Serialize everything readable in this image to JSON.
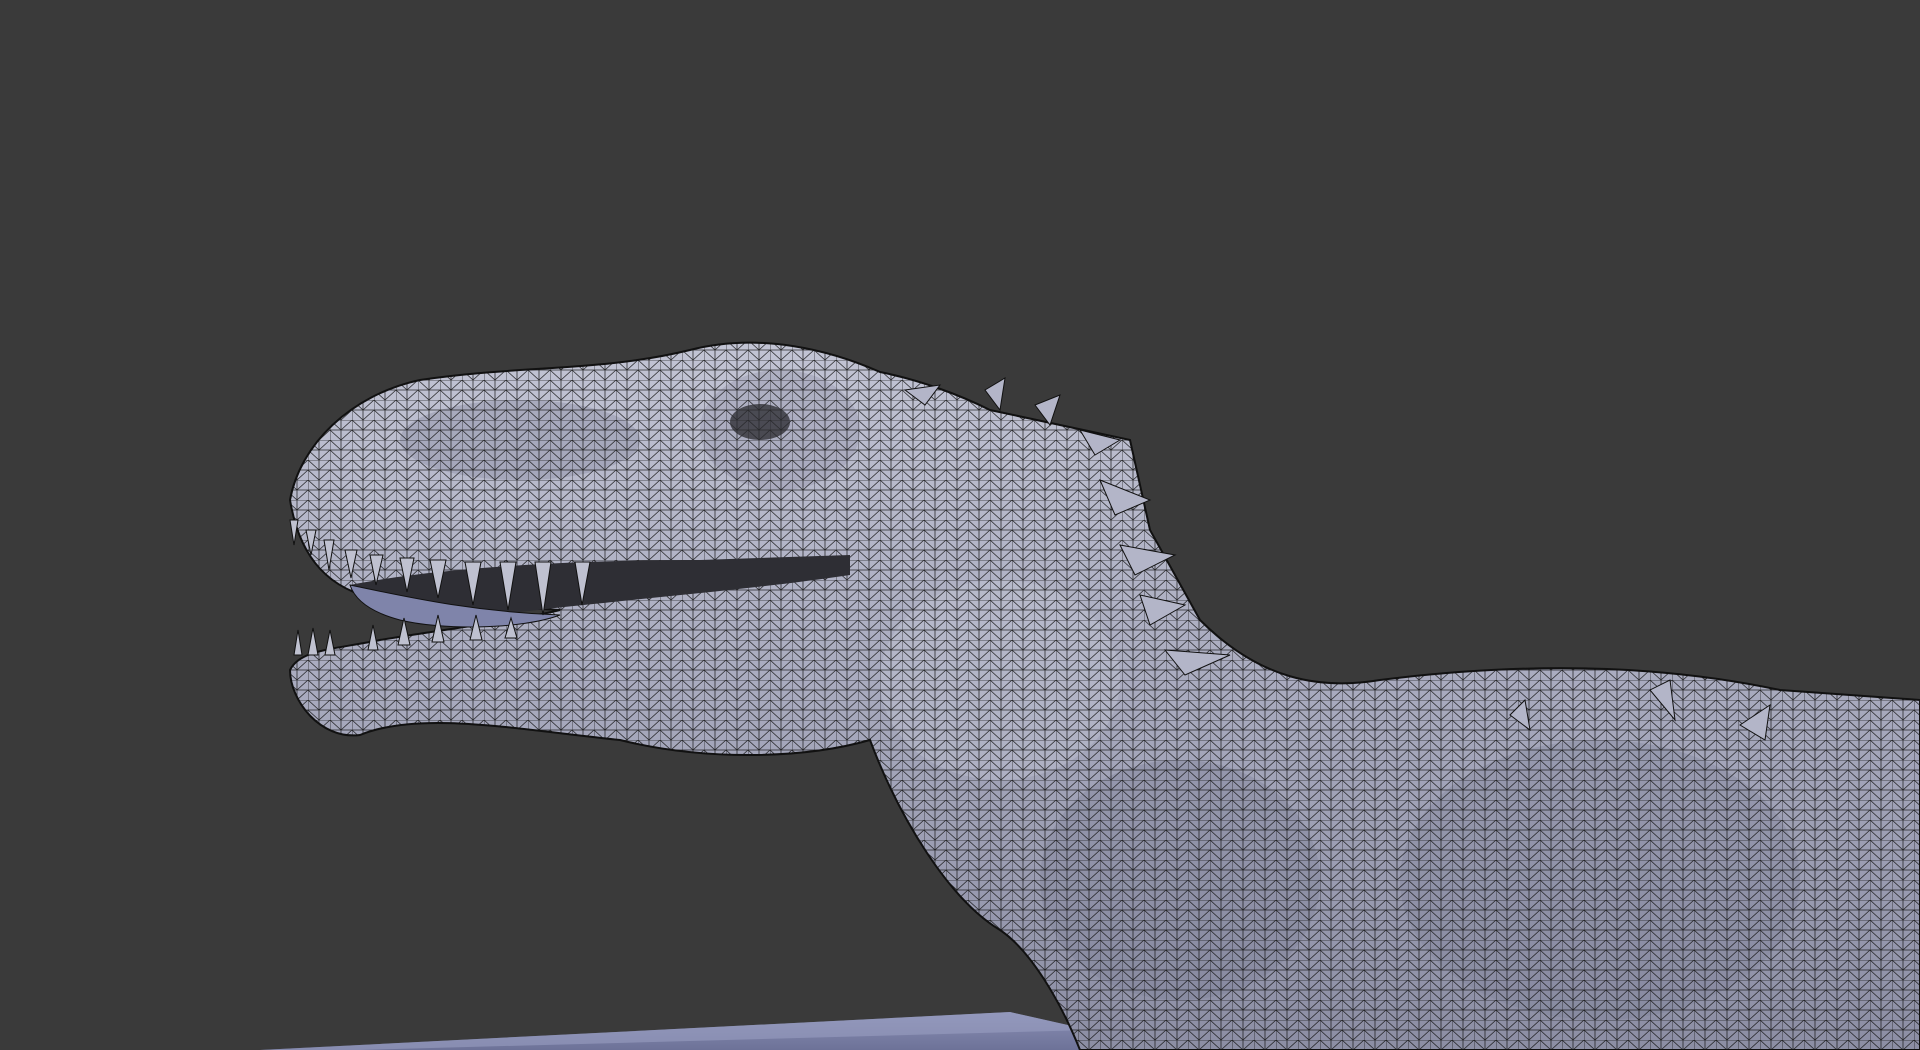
{
  "viewport": {
    "background_color": "#3a3a3a",
    "shading_mode": "solid-with-wireframe",
    "mesh_color": "#a8aabe",
    "wire_color": "#0a0a0a",
    "ground_color": "#7b80a6"
  },
  "scene": {
    "objects": [
      {
        "name_icon": "dinosaur-mesh",
        "selected": false
      },
      {
        "name_icon": "ground-plane",
        "selected": false
      }
    ]
  }
}
